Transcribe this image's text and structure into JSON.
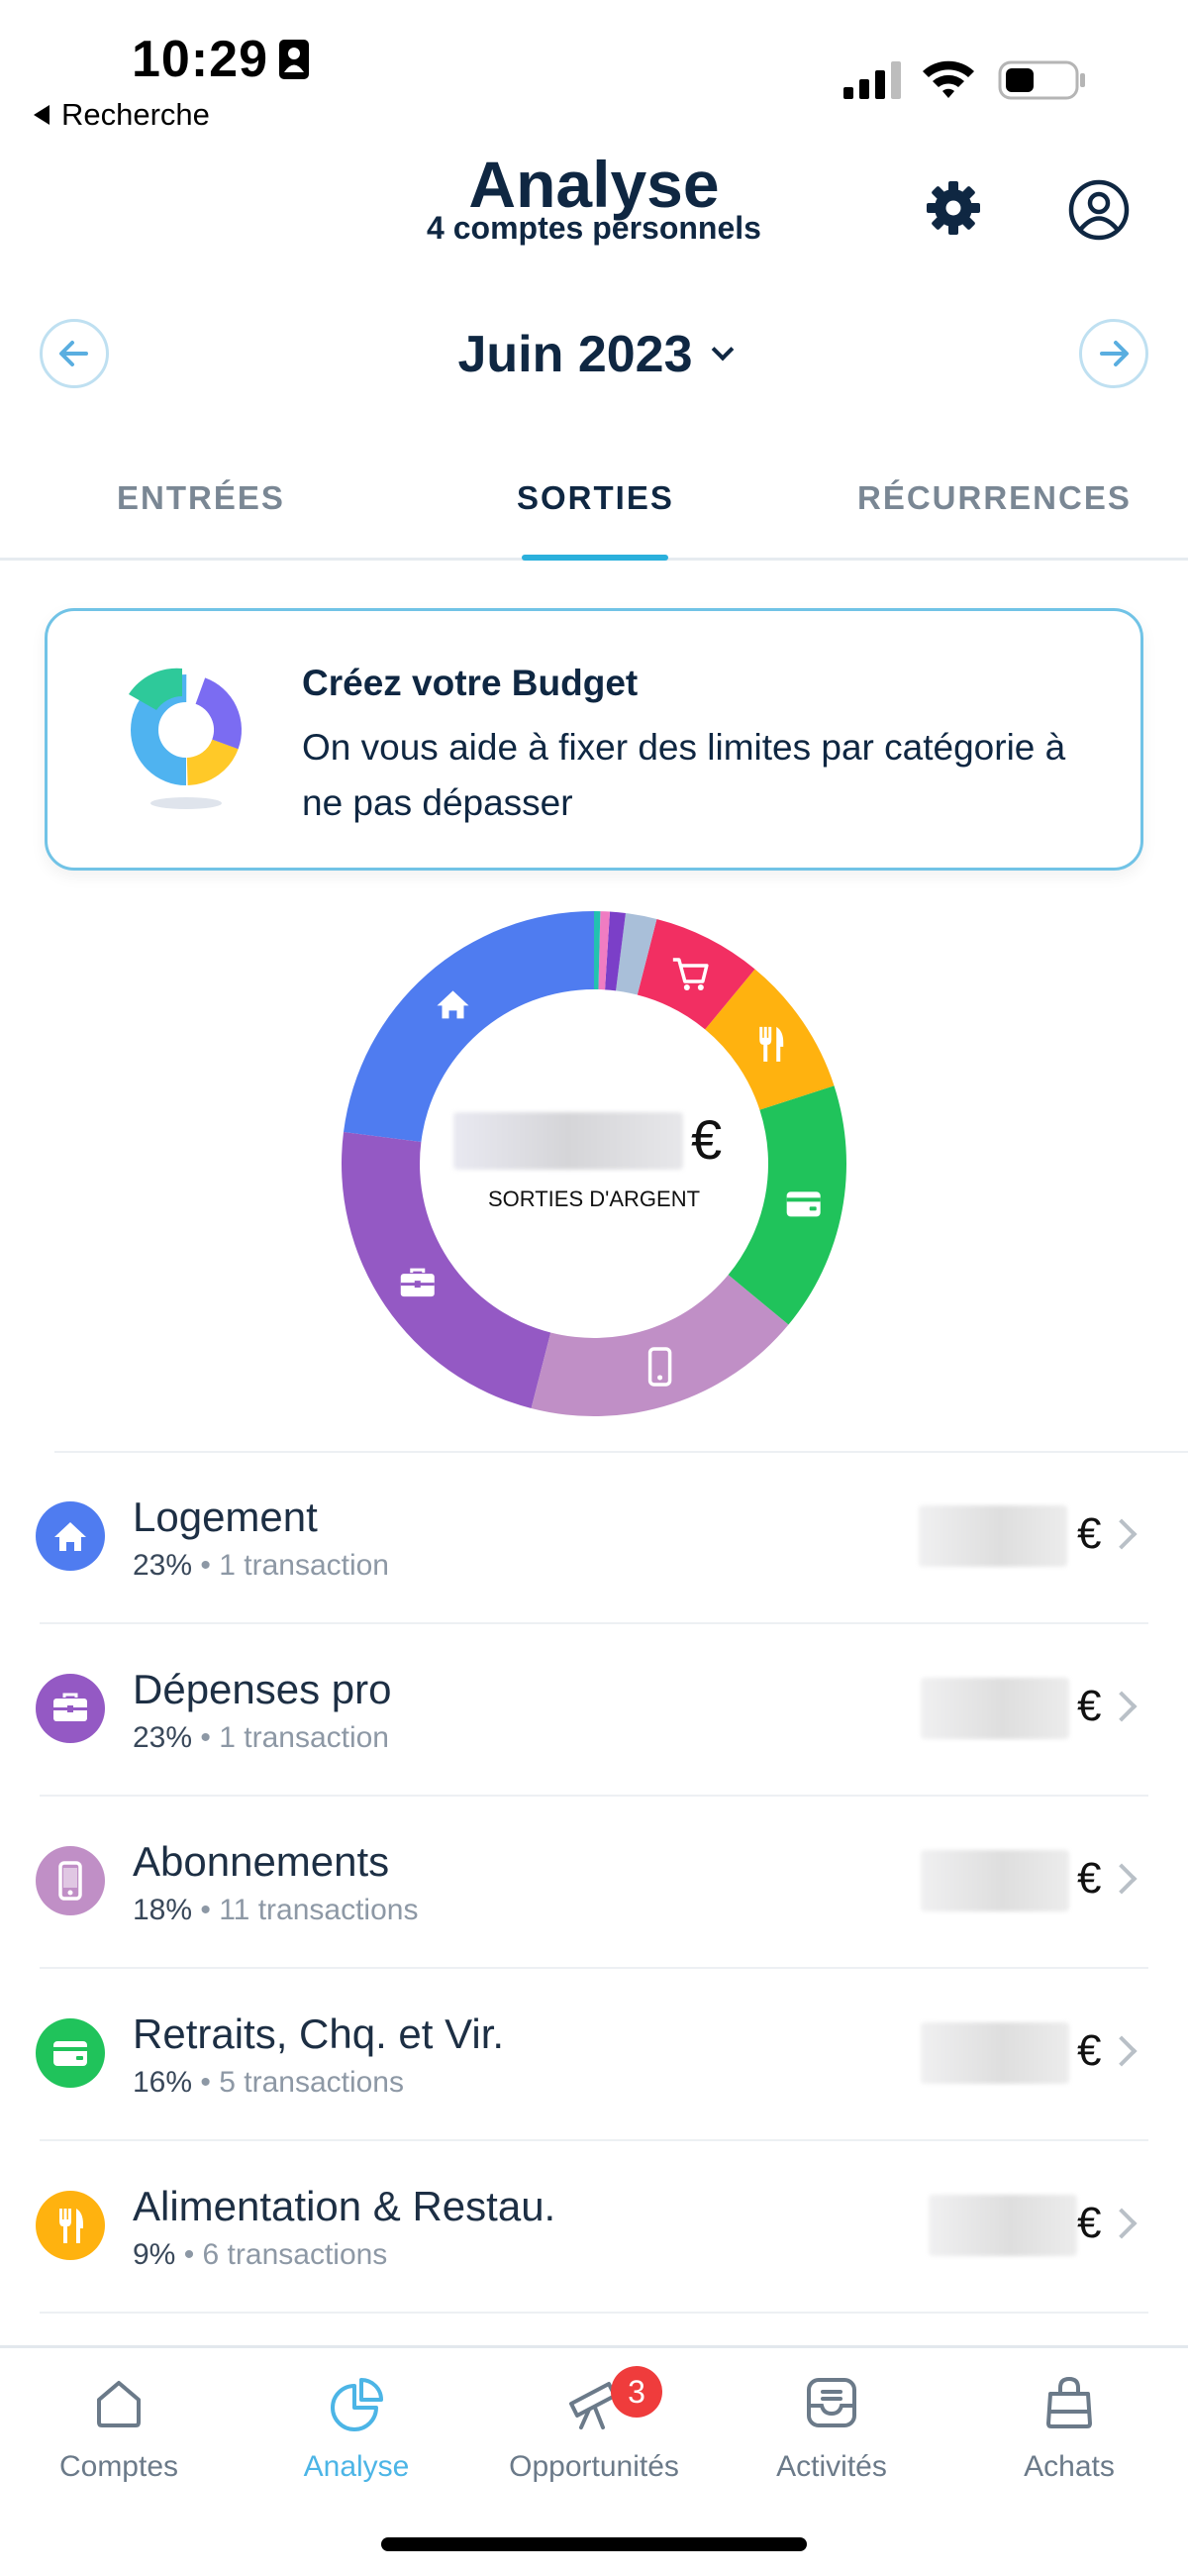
{
  "status_bar": {
    "time": "10:29",
    "back_label": "Recherche"
  },
  "header": {
    "title": "Analyse",
    "subtitle": "4 comptes personnels"
  },
  "period": {
    "label": "Juin 2023"
  },
  "tabs": [
    {
      "label": "ENTRÉES",
      "active": false
    },
    {
      "label": "SORTIES",
      "active": true
    },
    {
      "label": "RÉCURRENCES",
      "active": false
    }
  ],
  "budget_card": {
    "title": "Créez votre Budget",
    "text": "On vous aide à fixer des limites par catégorie à ne pas dépasser"
  },
  "donut": {
    "currency": "€",
    "label": "SORTIES D'ARGENT",
    "segments": [
      {
        "icon": "home-icon",
        "color": "#4f7cf0",
        "pct": 23
      },
      {
        "icon": "briefcase-icon",
        "color": "#9459c4",
        "pct": 23
      },
      {
        "icon": "phone-icon",
        "color": "#c08fc6",
        "pct": 18
      },
      {
        "icon": "card-icon",
        "color": "#20c35b",
        "pct": 16
      },
      {
        "icon": "cutlery-icon",
        "color": "#ffb20f",
        "pct": 9
      },
      {
        "icon": "cart-icon",
        "color": "#f22f62",
        "pct": 7
      },
      {
        "icon": "",
        "color": "#a9bfd9",
        "pct": 2
      },
      {
        "icon": "",
        "color": "#7b3fc8",
        "pct": 1
      },
      {
        "icon": "",
        "color": "#f07cc2",
        "pct": 0.6
      },
      {
        "icon": "",
        "color": "#22c2b0",
        "pct": 0.4
      }
    ]
  },
  "categories": [
    {
      "name": "Logement",
      "pct": "23%",
      "transactions": "• 1 transaction",
      "currency": "€",
      "color": "#4f7cf0",
      "icon": "home-icon"
    },
    {
      "name": "Dépenses pro",
      "pct": "23%",
      "transactions": "• 1 transaction",
      "currency": "€",
      "color": "#9459c4",
      "icon": "briefcase-icon"
    },
    {
      "name": "Abonnements",
      "pct": "18%",
      "transactions": "• 11 transactions",
      "currency": "€",
      "color": "#c08fc6",
      "icon": "phone-icon"
    },
    {
      "name": "Retraits, Chq. et Vir.",
      "pct": "16%",
      "transactions": "• 5 transactions",
      "currency": "€",
      "color": "#20c35b",
      "icon": "card-icon"
    },
    {
      "name": "Alimentation & Restau.",
      "pct": "9%",
      "transactions": "• 6 transactions",
      "currency": "€",
      "color": "#ffb20f",
      "icon": "cutlery-icon"
    }
  ],
  "bottom_nav": [
    {
      "label": "Comptes",
      "icon": "house-outline-icon",
      "active": false
    },
    {
      "label": "Analyse",
      "icon": "pie-outline-icon",
      "active": true
    },
    {
      "label": "Opportunités",
      "icon": "telescope-icon",
      "active": false,
      "badge": "3"
    },
    {
      "label": "Activités",
      "icon": "inbox-icon",
      "active": false
    },
    {
      "label": "Achats",
      "icon": "bag-icon",
      "active": false
    }
  ],
  "colors": {
    "accent": "#2bb0dc",
    "navy": "#0f2742",
    "badge": "#ef3c3c"
  }
}
